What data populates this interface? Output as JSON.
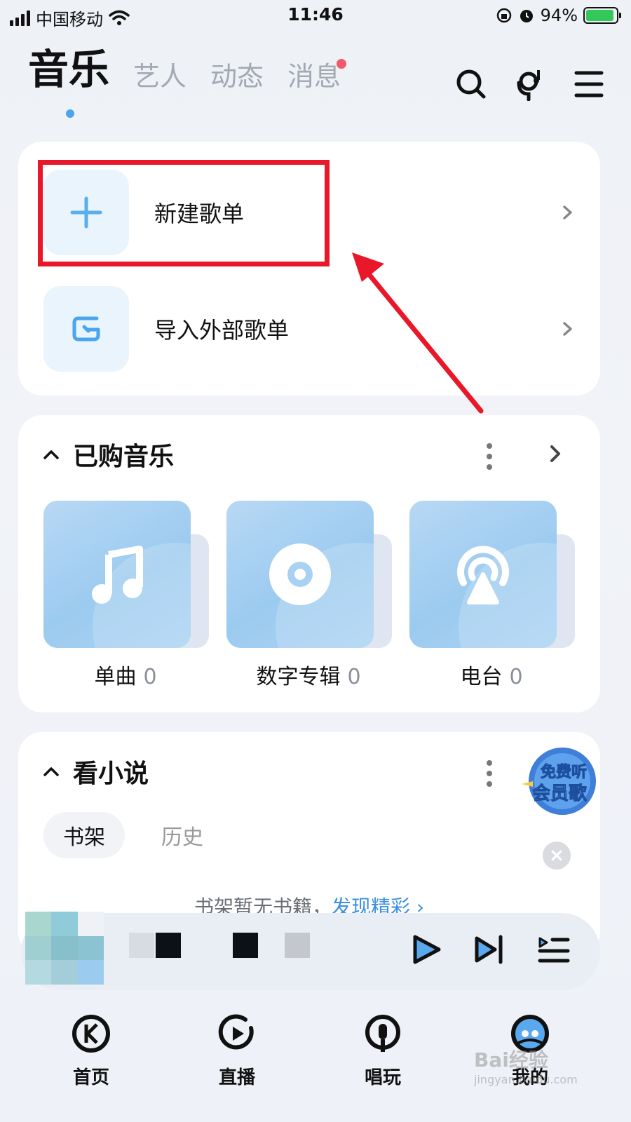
{
  "status_bar": {
    "carrier": "中国移动",
    "time": "11:46",
    "battery": "94%"
  },
  "top_tabs": [
    {
      "label": "音乐",
      "active": true
    },
    {
      "label": "艺人",
      "active": false
    },
    {
      "label": "动态",
      "active": false
    },
    {
      "label": "消息",
      "active": false,
      "badge_dot": true
    }
  ],
  "top_icons": [
    "search-icon",
    "mic-music-icon",
    "menu-icon"
  ],
  "playlist_actions": [
    {
      "label": "新建歌单",
      "icon": "plus-icon"
    },
    {
      "label": "导入外部歌单",
      "icon": "import-icon"
    }
  ],
  "purchased": {
    "title": "已购音乐",
    "items": [
      {
        "label": "单曲",
        "count": "0",
        "icon": "music-note-icon"
      },
      {
        "label": "数字专辑",
        "count": "0",
        "icon": "disc-icon"
      },
      {
        "label": "电台",
        "count": "0",
        "icon": "radio-icon"
      }
    ]
  },
  "novel": {
    "title": "看小说",
    "tabs": [
      "书架",
      "历史"
    ],
    "empty_text": "书架暂无书籍，",
    "empty_link": "发现精彩 ›",
    "promo_line1": "免费听",
    "promo_line2": "会员歌"
  },
  "player": {
    "controls": [
      "play-icon",
      "next-icon",
      "playlist-icon"
    ]
  },
  "bottom_nav": [
    {
      "label": "首页",
      "icon": "k-logo-icon"
    },
    {
      "label": "直播",
      "icon": "live-play-icon"
    },
    {
      "label": "唱玩",
      "icon": "mic-icon"
    },
    {
      "label": "我的",
      "icon": "avatar-icon"
    }
  ],
  "watermark": {
    "main": "Bai经验",
    "sub": "jingyan.baidu.com"
  },
  "colors": {
    "accent": "#4aa5ee",
    "highlight": "#e8182a",
    "badge": "#f25a6b"
  }
}
